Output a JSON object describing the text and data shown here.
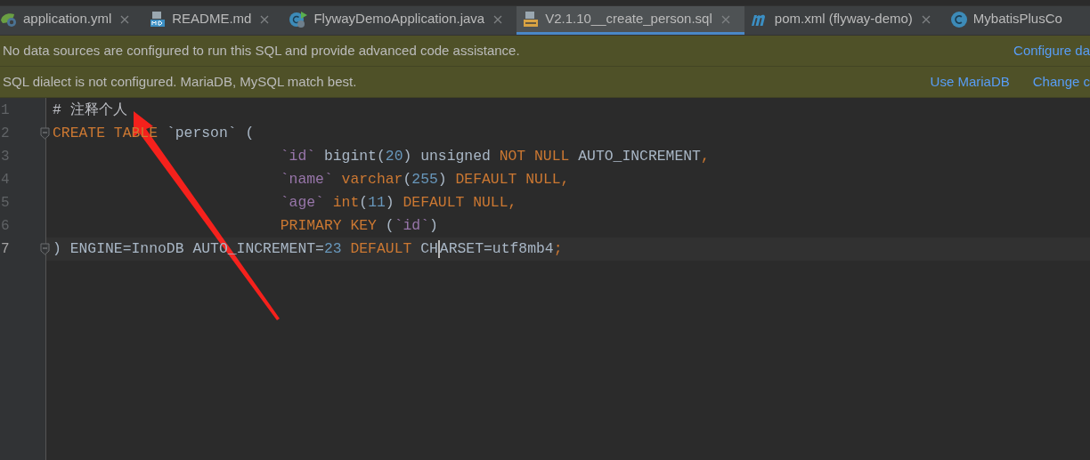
{
  "tabs": [
    {
      "label": "application.yml",
      "kind": "spring",
      "selected": false,
      "closable": true
    },
    {
      "label": "README.md",
      "kind": "markdown",
      "selected": false,
      "closable": true
    },
    {
      "label": "FlywayDemoApplication.java",
      "kind": "runnable",
      "selected": false,
      "closable": true
    },
    {
      "label": "V2.1.10__create_person.sql",
      "kind": "script",
      "selected": true,
      "closable": true
    },
    {
      "label": "pom.xml (flyway-demo)",
      "kind": "build",
      "selected": false,
      "closable": true
    },
    {
      "label": "MybatisPlusCo",
      "kind": "class",
      "selected": false,
      "closable": false
    }
  ],
  "banners": [
    {
      "message": "No data sources are configured to run this SQL and provide advanced code assistance.",
      "links": [
        "Configure da"
      ]
    },
    {
      "message": "SQL dialect is not configured. MariaDB, MySQL match best.",
      "links": [
        "Use MariaDB",
        "Change c"
      ]
    }
  ],
  "editor": {
    "lines": [
      {
        "number": "1",
        "current": false,
        "fold": false,
        "tokens": [
          {
            "kind": "comment",
            "text": "# 注释个人"
          }
        ]
      },
      {
        "number": "2",
        "current": false,
        "fold": true,
        "tokens": [
          {
            "kind": "keyword",
            "text": "CREATE TABLE "
          },
          {
            "kind": "plain",
            "text": "`person` ("
          }
        ],
        "children": [
          {
            "number": "3",
            "current": false,
            "fold": false,
            "tokens": [
              {
                "kind": "ident",
                "text": "`id`"
              },
              {
                "kind": "plain",
                "text": " bigint("
              },
              {
                "kind": "number",
                "text": "20"
              },
              {
                "kind": "plain",
                "text": ") unsigned "
              },
              {
                "kind": "keyword",
                "text": "NOT NULL "
              },
              {
                "kind": "plain",
                "text": "AUTO_INCREMENT"
              },
              {
                "kind": "keyword",
                "text": ","
              }
            ]
          },
          {
            "number": "4",
            "current": false,
            "fold": false,
            "tokens": [
              {
                "kind": "ident",
                "text": "`name`"
              },
              {
                "kind": "keyword",
                "text": " varchar"
              },
              {
                "kind": "plain",
                "text": "("
              },
              {
                "kind": "number",
                "text": "255"
              },
              {
                "kind": "plain",
                "text": ") "
              },
              {
                "kind": "keyword",
                "text": "DEFAULT NULL,"
              }
            ]
          },
          {
            "number": "5",
            "current": false,
            "fold": false,
            "tokens": [
              {
                "kind": "ident",
                "text": "`age`"
              },
              {
                "kind": "keyword",
                "text": " int"
              },
              {
                "kind": "plain",
                "text": "("
              },
              {
                "kind": "number",
                "text": "11"
              },
              {
                "kind": "plain",
                "text": ") "
              },
              {
                "kind": "keyword",
                "text": "DEFAULT NULL,"
              }
            ]
          },
          {
            "number": "6",
            "current": false,
            "fold": false,
            "tokens": [
              {
                "kind": "keyword",
                "text": "PRIMARY KEY "
              },
              {
                "kind": "plain",
                "text": "("
              },
              {
                "kind": "ident",
                "text": "`id`"
              },
              {
                "kind": "plain",
                "text": ")"
              }
            ]
          }
        ]
      },
      {
        "number": "7",
        "current": true,
        "fold": true,
        "tokens": [
          {
            "kind": "plain",
            "text": ") ENGINE=InnoDB AUTO_INCREMENT="
          },
          {
            "kind": "number",
            "text": "23"
          },
          {
            "kind": "keyword",
            "text": " DEFAULT "
          },
          {
            "kind": "plain",
            "text": "CH"
          },
          {
            "kind": "caret"
          },
          {
            "kind": "plain",
            "text": "ARSET=utf8mb4"
          },
          {
            "kind": "keyword",
            "text": ";"
          }
        ]
      }
    ]
  }
}
